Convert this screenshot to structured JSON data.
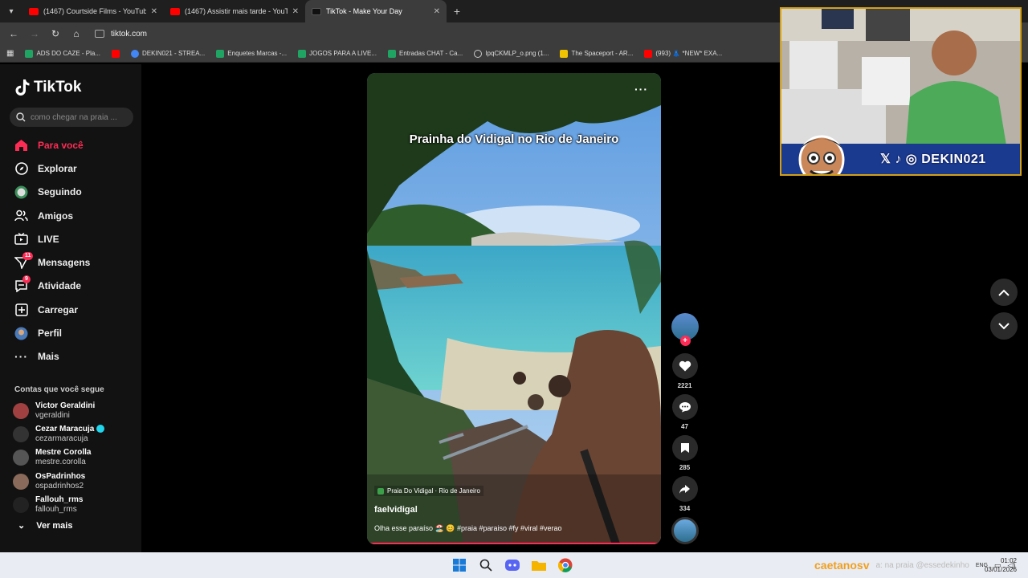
{
  "browser": {
    "tabs": [
      {
        "title": "(1467) Courtside Films - YouTub",
        "active": false,
        "icon": "youtube-icon"
      },
      {
        "title": "(1467) Assistir mais tarde - YouT",
        "active": false,
        "icon": "youtube-icon"
      },
      {
        "title": "TikTok - Make Your Day",
        "active": true,
        "icon": "tiktok-icon"
      }
    ],
    "url": "tiktok.com",
    "bookmarks": [
      {
        "label": "ADS DO CAZE - Pla...",
        "icon": "sheets"
      },
      {
        "label": "",
        "icon": "youtube"
      },
      {
        "label": "DEKIN021 - STREA...",
        "icon": "drive"
      },
      {
        "label": "Enquetes Marcas -...",
        "icon": "sheets"
      },
      {
        "label": "JOGOS PARA A LIVE...",
        "icon": "sheets"
      },
      {
        "label": "Entradas CHAT - Ca...",
        "icon": "sheets"
      },
      {
        "label": "IpqCKMLP_o.png (1...",
        "icon": "globe"
      },
      {
        "label": "The Spaceport - AR...",
        "icon": "y"
      },
      {
        "label": "(993) 👗 *NEW* EXA...",
        "icon": "youtube"
      }
    ]
  },
  "sidebar": {
    "logo": "TikTok",
    "search_placeholder": "como chegar na praia ...",
    "menu": [
      {
        "label": "Para você",
        "icon": "home-icon",
        "active": true
      },
      {
        "label": "Explorar",
        "icon": "compass-icon"
      },
      {
        "label": "Seguindo",
        "icon": "following-icon"
      },
      {
        "label": "Amigos",
        "icon": "friends-icon"
      },
      {
        "label": "LIVE",
        "icon": "live-icon"
      },
      {
        "label": "Mensagens",
        "icon": "messages-icon",
        "badge": "11"
      },
      {
        "label": "Atividade",
        "icon": "activity-icon",
        "badge": "9"
      },
      {
        "label": "Carregar",
        "icon": "upload-icon"
      },
      {
        "label": "Perfil",
        "icon": "profile-icon"
      },
      {
        "label": "Mais",
        "icon": "more-icon"
      }
    ],
    "following_title": "Contas que você segue",
    "following": [
      {
        "name": "Victor Geraldini",
        "handle": "vgeraldini",
        "verified": false
      },
      {
        "name": "Cezar Maracuja",
        "handle": "cezarmaracuja",
        "verified": true
      },
      {
        "name": "Mestre Corolla",
        "handle": "mestre.corolla",
        "verified": false
      },
      {
        "name": "OsPadrinhos",
        "handle": "ospadrinhos2",
        "verified": false
      },
      {
        "name": "Fallouh_rms",
        "handle": "fallouh_rms",
        "verified": false
      }
    ],
    "see_more": "Ver mais"
  },
  "video": {
    "title": "Prainha do Vidigal no Rio de Janeiro",
    "location": "Praia Do Vidigal · Rio de Janeiro",
    "username": "faelvidigal",
    "caption": "Olha esse paraíso 🏖️ 😊 #praia #paraiso #fy #viral #verao",
    "likes": "2221",
    "comments": "47",
    "saves": "285",
    "shares": "334"
  },
  "stream_overlay": {
    "handle": "DEKIN021"
  },
  "taskbar": {
    "tray_handle": "caetanosv",
    "tray_faded": "a: na praia @essedekinho",
    "lang": "ENG",
    "time": "01:02",
    "date": "03/01/2026"
  },
  "colors": {
    "accent": "#fe2c55",
    "overlay_border": "#d4a017"
  }
}
